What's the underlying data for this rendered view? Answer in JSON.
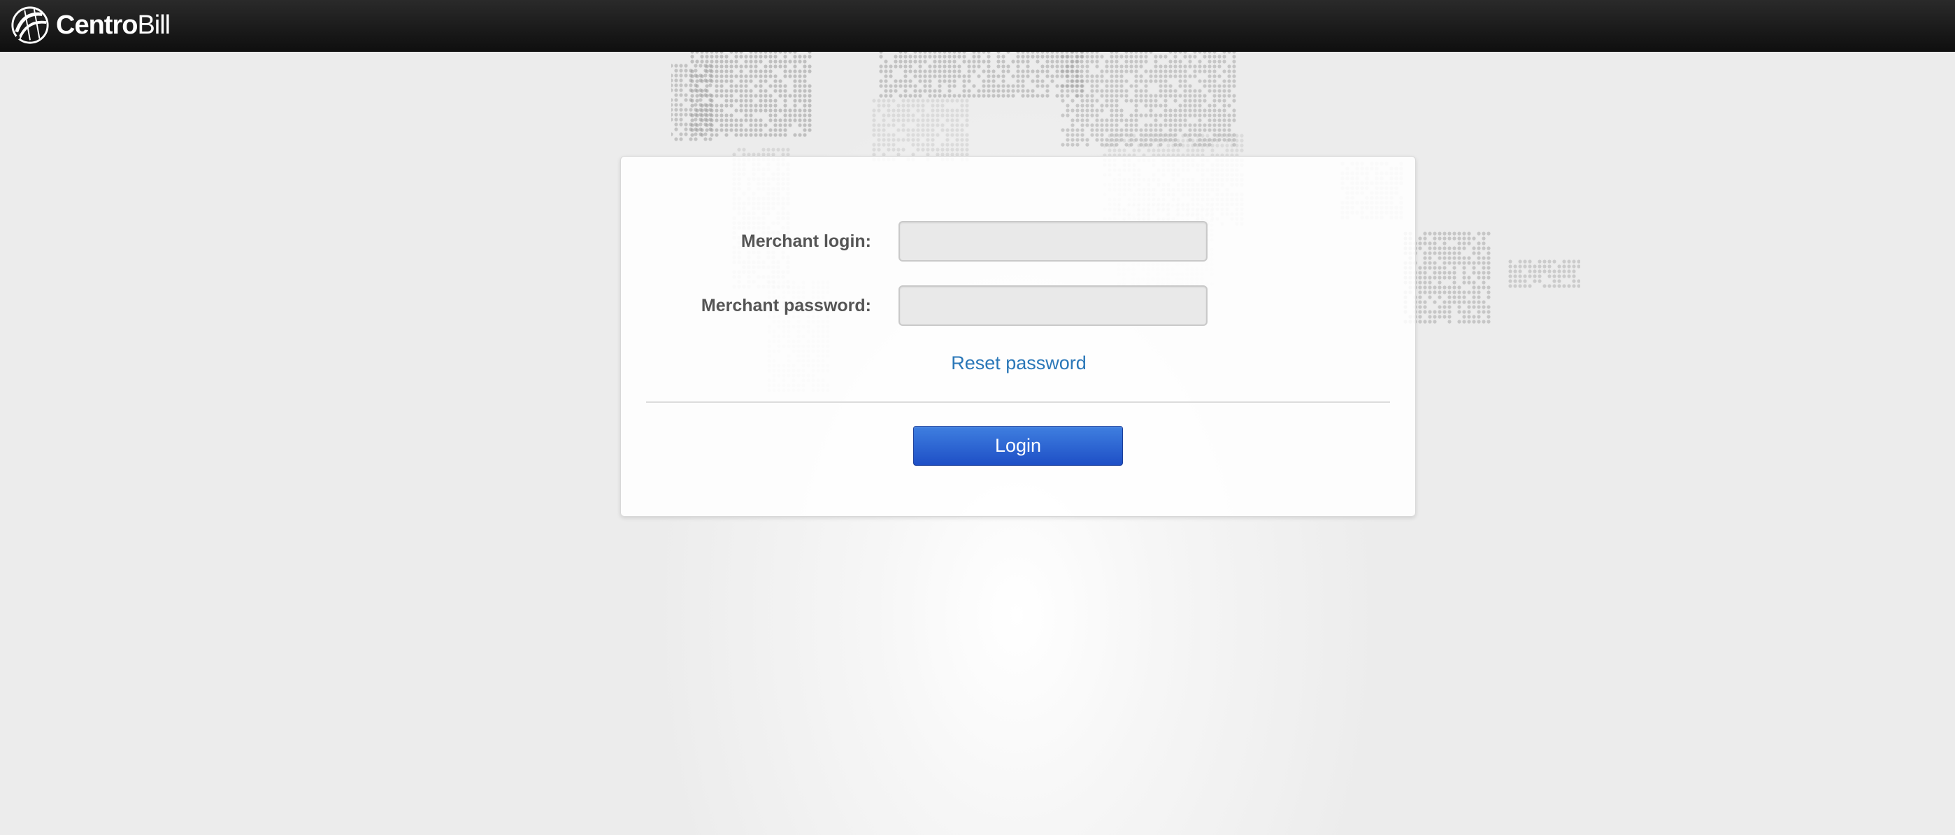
{
  "header": {
    "logo_text_bold": "Centro",
    "logo_text_light": "Bill",
    "logo_icon": "globe-swirl-icon",
    "background_color": "#1a1a1a"
  },
  "form": {
    "login_label": "Merchant login:",
    "login_value": "",
    "password_label": "Merchant password:",
    "password_value": "",
    "reset_link": "Reset password",
    "submit_label": "Login"
  },
  "colors": {
    "accent": "#2a5fd0",
    "link": "#2a77b8",
    "page_background": "#ececec"
  }
}
